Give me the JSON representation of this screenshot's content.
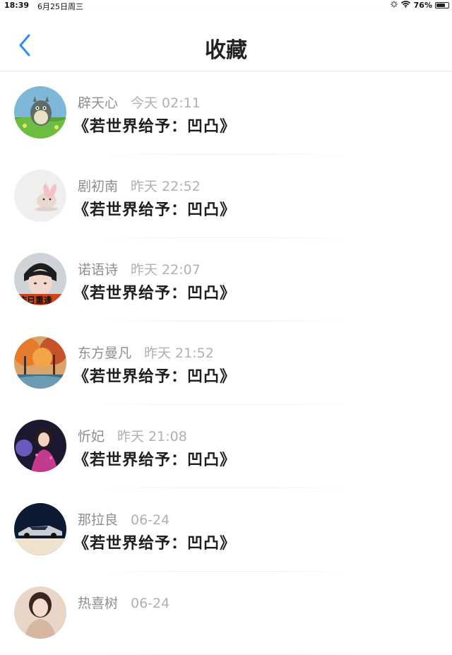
{
  "statusbar": {
    "time": "18:39",
    "date": "6月25日周三",
    "battery_text": "76%",
    "battery_level": 0.76
  },
  "header": {
    "title": "收藏"
  },
  "favorites": [
    {
      "name": "辟天心",
      "time": "今天 02:11",
      "title": "《若世界给予：凹凸》",
      "avatar": "totoro-avatar"
    },
    {
      "name": "剧初南",
      "time": "昨天 22:52",
      "title": "《若世界给予：凹凸》",
      "avatar": "bunny-avatar"
    },
    {
      "name": "诺语诗",
      "time": "昨天 22:07",
      "title": "《若世界给予：凹凸》",
      "avatar": "boy-avatar"
    },
    {
      "name": "东方曼凡",
      "time": "昨天 21:52",
      "title": "《若世界给予：凹凸》",
      "avatar": "autumn-avatar"
    },
    {
      "name": "忻妃",
      "time": "昨天 21:08",
      "title": "《若世界给予：凹凸》",
      "avatar": "girl-avatar"
    },
    {
      "name": "那拉良",
      "time": "06-24",
      "title": "《若世界给予：凹凸》",
      "avatar": "car-avatar"
    },
    {
      "name": "热喜树",
      "time": "06-24",
      "title": "",
      "avatar": "woman-avatar"
    }
  ],
  "colors": {
    "accent": "#2f8fe6",
    "name_gray": "#8e8e8e",
    "time_gray": "#b0b0b0",
    "title_text": "#1e1e1e"
  }
}
